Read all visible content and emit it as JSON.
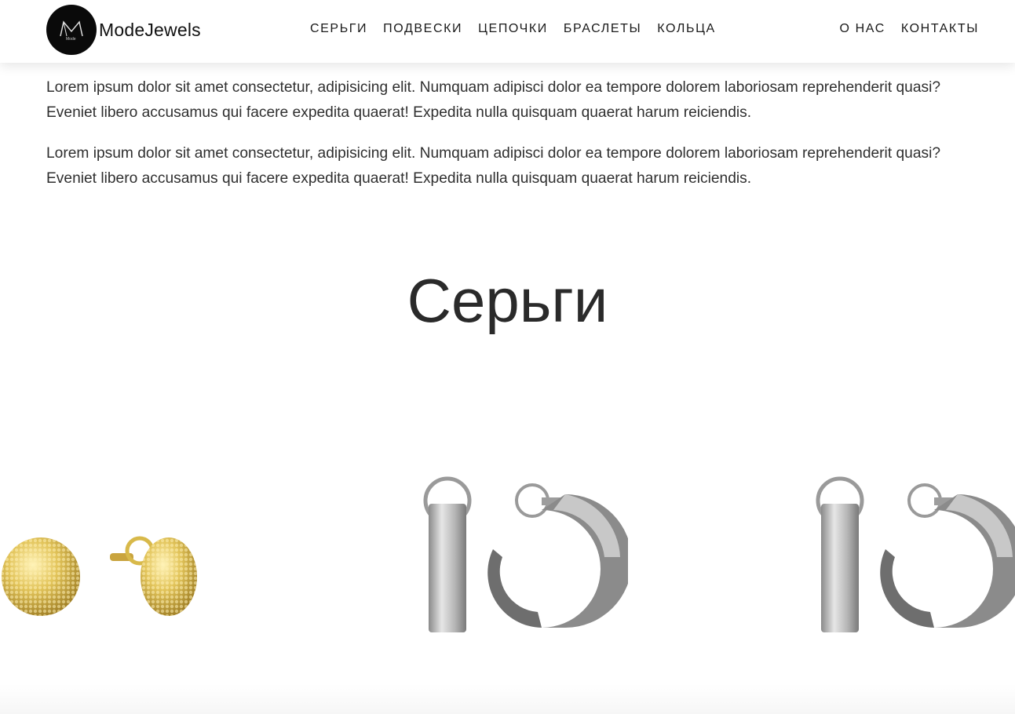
{
  "header": {
    "logo_mark": "Mode",
    "brand": "ModeJewels",
    "nav_main": [
      "СЕРЬГИ",
      "ПОДВЕСКИ",
      "ЦЕПОЧКИ",
      "БРАСЛЕТЫ",
      "КОЛЬЦА"
    ],
    "nav_right": [
      "О НАС",
      "КОНТАКТЫ"
    ]
  },
  "intro": {
    "paragraphs": [
      "Lorem ipsum dolor sit amet consectetur, adipisicing elit. Numquam adipisci dolor ea tempore dolorem laboriosam reprehenderit quasi? Eveniet libero accusamus qui facere expedita quaerat! Expedita nulla quisquam quaerat harum reiciendis.",
      "Lorem ipsum dolor sit amet consectetur, adipisicing elit. Numquam adipisci dolor ea tempore dolorem laboriosam reprehenderit quasi? Eveniet libero accusamus qui facere expedita quaerat! Expedita nulla quisquam quaerat harum reiciendis."
    ]
  },
  "section": {
    "title": "Серьги"
  },
  "products": [
    {
      "image": "gold-textured-stud-earrings"
    },
    {
      "image": "silver-hoop-earrings"
    },
    {
      "image": "silver-hoop-earrings"
    }
  ],
  "colors": {
    "brand_dark": "#0a0a0a",
    "gold": "#d8b94a",
    "silver": "#a9a9a9"
  }
}
